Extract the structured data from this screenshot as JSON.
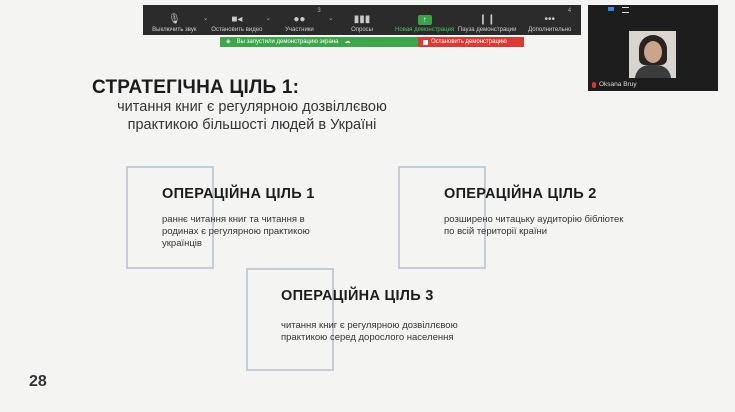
{
  "toolbar": {
    "buttons": [
      {
        "label": "Выключить звук",
        "icon": "microphone-icon"
      },
      {
        "label": "Остановить видео",
        "icon": "video-camera-icon"
      },
      {
        "label": "Участники",
        "icon": "participants-icon",
        "count": "3"
      },
      {
        "label": "Опросы",
        "icon": "polls-icon"
      },
      {
        "label": "Новая демонстрация",
        "icon": "share-screen-icon"
      },
      {
        "label": "Пауза демонстрации",
        "icon": "pause-icon"
      },
      {
        "label": "Дополнительно",
        "icon": "more-icon",
        "count": "4"
      }
    ]
  },
  "share_status": {
    "message": "Вы запустили демонстрацию экрана",
    "stop_label": "Остановить демонстрацию"
  },
  "video": {
    "participant_name": "Oksana Bruy"
  },
  "slide": {
    "title": "СТРАТЕГІЧНА ЦІЛЬ 1:",
    "subtitle": "читання книг є регулярною дозвіллєвою практикою більшості людей в Україні",
    "op1": {
      "title": "ОПЕРАЦІЙНА ЦІЛЬ 1",
      "text": "раннє читання книг та читання в родинах є регулярною практикою українців"
    },
    "op2": {
      "title": "ОПЕРАЦІЙНА ЦІЛЬ 2",
      "text": "розширено читацьку аудиторію бібліотек по всій території країни"
    },
    "op3": {
      "title": "ОПЕРАЦІЙНА ЦІЛЬ 3",
      "text": "читання книг є регулярною дозвіллєвою практикою серед дорослого населення"
    },
    "page_number": "28"
  },
  "colors": {
    "toolbar_bg": "#2b2b2b",
    "share_green": "#3da54b",
    "share_red": "#d93a36",
    "frame": "#c4ccd6"
  }
}
